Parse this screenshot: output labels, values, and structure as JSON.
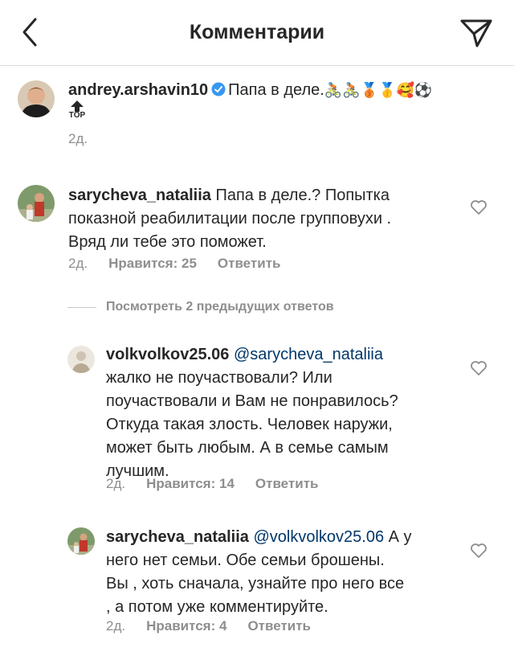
{
  "header": {
    "title": "Комментарии"
  },
  "caption": {
    "username": "andrey.arshavin10",
    "text": "Папа в деле.",
    "emojis": "🚴🏼🚴🏼🥉🥇🥰⚽️",
    "badge": "TOP",
    "time": "2д."
  },
  "comments": [
    {
      "username": "sarycheva_nataliia",
      "lines": [
        "Папа в деле.? Попытка",
        "показной реабилитации после групповухи .",
        "Вряд ли тебе это поможет."
      ],
      "time": "2д.",
      "likes": "Нравится: 25",
      "reply": "Ответить"
    }
  ],
  "view_replies": "Посмотреть 2 предыдущих ответов",
  "replies": [
    {
      "username": "volkvolkov25.06",
      "mention": "@sarycheva_nataliia",
      "lines": [
        "жалко не поучаствовали? Или",
        "поучаствовали и Вам не понравилось?",
        "Откуда такая злость. Человек наружи,",
        "может быть любым. А в семье самым",
        "лучшим."
      ],
      "time": "2д.",
      "likes": "Нравится: 14",
      "reply": "Ответить"
    },
    {
      "username": "sarycheva_nataliia",
      "mention": "@volkvolkov25.06",
      "first_tail": "А у",
      "lines": [
        "него нет семьи. Обе семьи брошены.",
        "Вы , хоть сначала, узнайте про него все",
        ", а потом уже комментируйте."
      ],
      "time": "2д.",
      "likes": "Нравится: 4",
      "reply": "Ответить"
    }
  ]
}
